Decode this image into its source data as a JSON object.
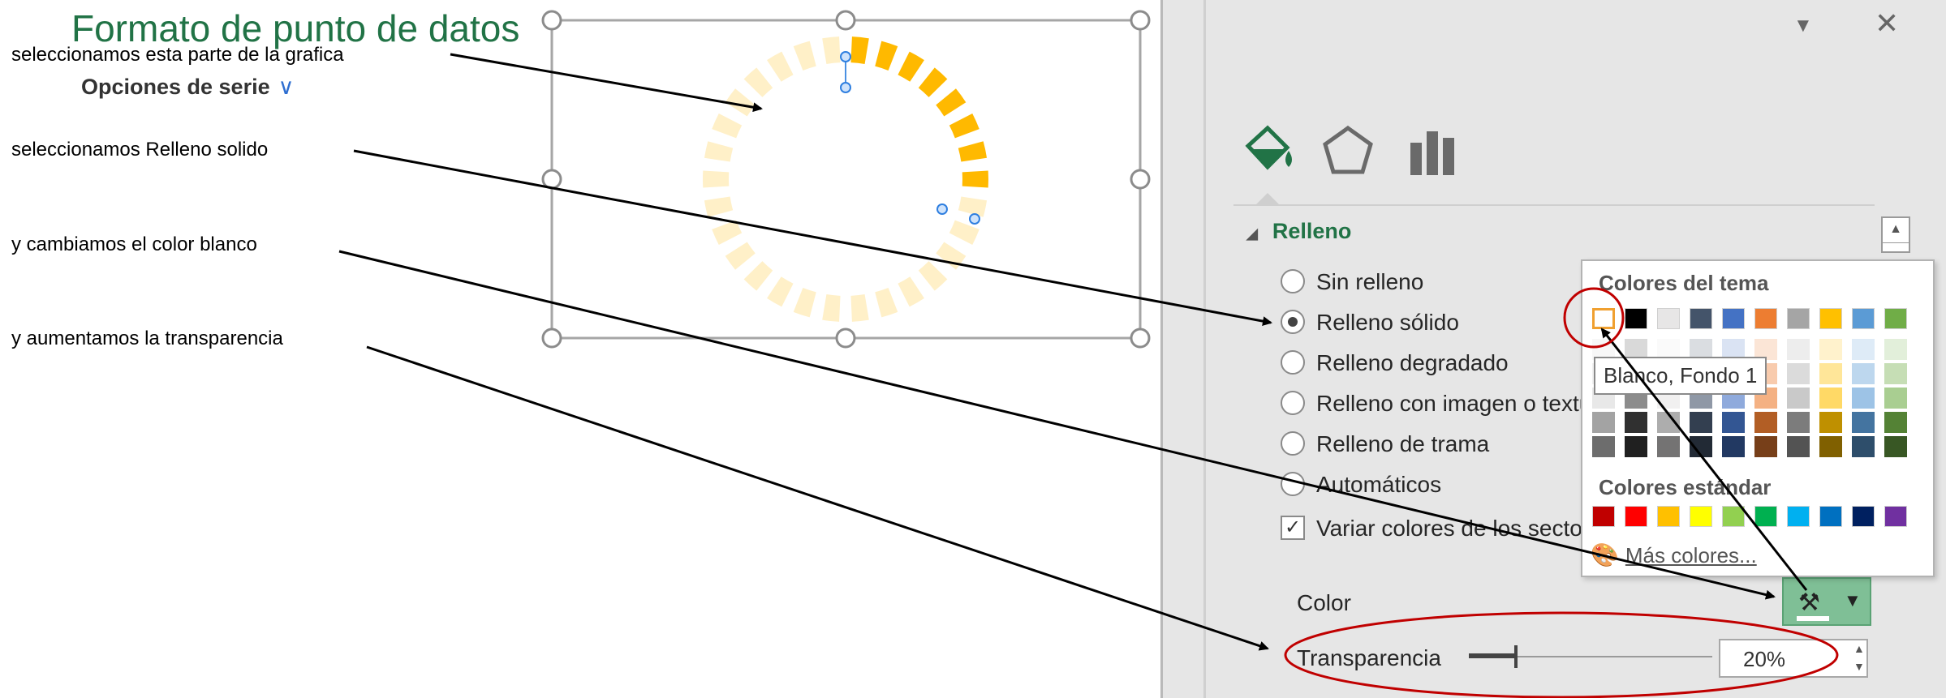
{
  "annotations": [
    "seleccionamos esta parte de la grafica",
    "seleccionamos Relleno solido",
    "y cambiamos el color blanco",
    "y aumentamos la transparencia"
  ],
  "chart_data": {
    "type": "doughnut",
    "segments_total": 30,
    "highlighted_segments": 8,
    "highlight_color": "#ffb900",
    "faded_color": "#fff0c8"
  },
  "pane": {
    "title": "Formato de punto de datos",
    "dropdown_icon": "▼",
    "close_icon": "✕",
    "series_options": "Opciones de serie",
    "series_chevron": "∨",
    "section_fill": "Relleno",
    "fill_options": [
      "Sin relleno",
      "Relleno sólido",
      "Relleno degradado",
      "Relleno con imagen o textura",
      "Relleno de trama",
      "Automáticos"
    ],
    "selected_fill_index": 1,
    "vary_colors": "Variar colores de los sectores",
    "color_label": "Color",
    "transparency_label": "Transparencia",
    "transparency_value": "20%",
    "transparency_level": 20
  },
  "picker": {
    "theme_colors_title": "Colores del tema",
    "standard_colors_title": "Colores estándar",
    "tooltip": "Blanco, Fondo 1",
    "more_colors": "Más colores...",
    "theme_colors": [
      "#ffffff",
      "#000000",
      "#e7e6e6",
      "#44546a",
      "#4472c4",
      "#ed7d31",
      "#a5a5a5",
      "#ffc000",
      "#5b9bd5",
      "#70ad47"
    ],
    "standard_colors": [
      "#c00000",
      "#ff0000",
      "#ffc000",
      "#ffff00",
      "#92d050",
      "#00b050",
      "#00b0f0",
      "#0070c0",
      "#002060",
      "#7030a0"
    ]
  },
  "colors": {
    "accent_green": "#217346",
    "highlight_red": "#c00000"
  }
}
